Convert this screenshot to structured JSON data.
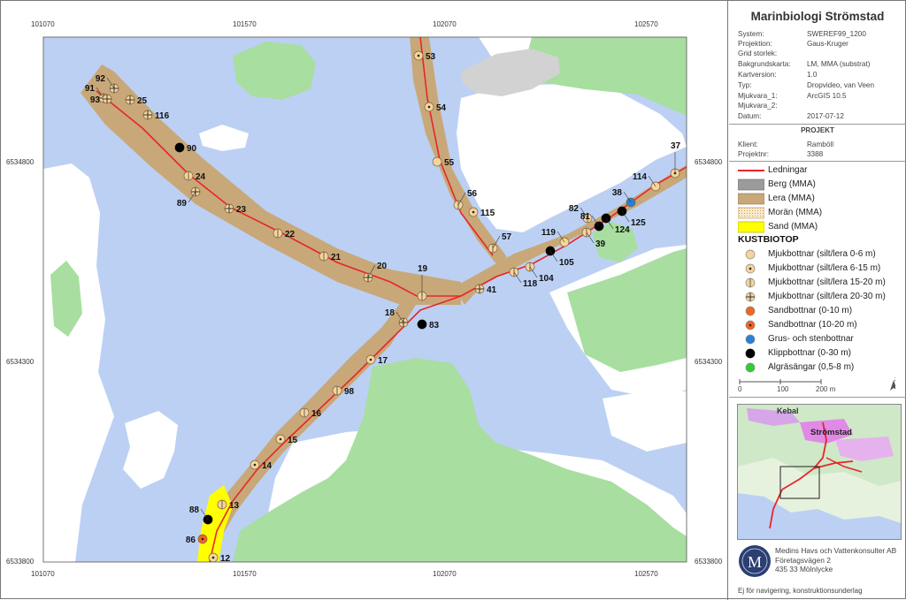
{
  "panel": {
    "title": "Marinbiologi Strömstad",
    "meta": [
      {
        "key": "System:",
        "value": "SWEREF99_1200"
      },
      {
        "key": "Projektion:",
        "value": "Gaus-Kruger"
      },
      {
        "key": "Grid storlek:",
        "value": ""
      },
      {
        "key": "Bakgrundskarta:",
        "value": "LM, MMA (substrat)"
      },
      {
        "key": "Kartversion:",
        "value": "1.0"
      },
      {
        "key": "Typ:",
        "value": "Dropvideo, van Veen"
      },
      {
        "key": "Mjukvara_1:",
        "value": "ArcGIS 10.5"
      },
      {
        "key": "Mjukvara_2:",
        "value": ""
      },
      {
        "key": "Datum:",
        "value": "2017-07-12"
      }
    ],
    "projekt_heading": "PROJEKT",
    "projekt": [
      {
        "key": "Klient:",
        "value": "Ramböll"
      },
      {
        "key": "Projektnr:",
        "value": "3388"
      }
    ],
    "legend": [
      {
        "label": "Ledningar",
        "symbol": "line",
        "color": "#e8252a"
      },
      {
        "label": "Berg (MMA)",
        "symbol": "rect",
        "color": "#9b9b9b"
      },
      {
        "label": "Lera (MMA)",
        "symbol": "rect",
        "color": "#c8a878"
      },
      {
        "label": "Morän (MMA)",
        "symbol": "dots",
        "color": "#f3dfb5"
      },
      {
        "label": "Sand (MMA)",
        "symbol": "rect",
        "color": "#ffff00"
      }
    ],
    "kustbiotop_heading": "KUSTBIOTOP",
    "kustbiotop": [
      {
        "label": "Mjukbottnar (silt/lera 0-6 m)",
        "style": "plain",
        "color": "#f6d49a"
      },
      {
        "label": "Mjukbottnar (silt/lera 6-15 m)",
        "style": "dot",
        "color": "#f6d49a"
      },
      {
        "label": "Mjukbottnar (silt/lera 15-20 m)",
        "style": "vline",
        "color": "#f6d49a"
      },
      {
        "label": "Mjukbottnar (silt/lera 20-30 m)",
        "style": "cross",
        "color": "#f6d49a"
      },
      {
        "label": "Sandbottnar (0-10 m)",
        "style": "plain",
        "color": "#f26522"
      },
      {
        "label": "Sandbottnar (10-20 m)",
        "style": "dot",
        "color": "#f26522"
      },
      {
        "label": "Grus- och stenbottnar",
        "style": "plain",
        "color": "#2a7fd6"
      },
      {
        "label": "Klippbottnar (0-30 m)",
        "style": "plain",
        "color": "#000000"
      },
      {
        "label": "Algräsängar (0,5-8 m)",
        "style": "plain",
        "color": "#33cc33"
      }
    ],
    "scale": {
      "labels": [
        "0",
        "100",
        "200 m"
      ]
    },
    "north_label": "N",
    "inset": {
      "labels": [
        "Kebal",
        "Strömstad"
      ]
    },
    "company": [
      "Medins Havs och Vattenkonsulter AB",
      "Företagsvägen 2",
      "435 33 Mölnlycke"
    ],
    "disclaimer": "Ej för navigering, konstruktionsunderlag"
  },
  "map": {
    "x_ticks": [
      "101070",
      "101570",
      "102070",
      "102570"
    ],
    "y_ticks": [
      "6534800",
      "6534300",
      "6533800"
    ],
    "colors": {
      "water": "#bcd0f4",
      "land": "#ffffff",
      "grass": "#a8dea0",
      "clay": "#c8a878",
      "rock": "#9b9b9b",
      "sand": "#ffff00",
      "cable": "#e8252a"
    },
    "stations": [
      {
        "id": "92",
        "type": "cross"
      },
      {
        "id": "91",
        "type": "cross"
      },
      {
        "id": "93",
        "type": "cross"
      },
      {
        "id": "25",
        "type": "cross"
      },
      {
        "id": "116",
        "type": "cross"
      },
      {
        "id": "90",
        "type": "rock"
      },
      {
        "id": "24",
        "type": "vline"
      },
      {
        "id": "89",
        "type": "cross"
      },
      {
        "id": "23",
        "type": "cross"
      },
      {
        "id": "22",
        "type": "vline"
      },
      {
        "id": "21",
        "type": "vline"
      },
      {
        "id": "20",
        "type": "cross"
      },
      {
        "id": "19",
        "type": "vline"
      },
      {
        "id": "41",
        "type": "cross"
      },
      {
        "id": "18",
        "type": "cross"
      },
      {
        "id": "83",
        "type": "rock"
      },
      {
        "id": "17",
        "type": "dot"
      },
      {
        "id": "98",
        "type": "vline"
      },
      {
        "id": "16",
        "type": "vline"
      },
      {
        "id": "15",
        "type": "dot"
      },
      {
        "id": "14",
        "type": "dot"
      },
      {
        "id": "13",
        "type": "vline"
      },
      {
        "id": "88",
        "type": "rock"
      },
      {
        "id": "86",
        "type": "sanddot"
      },
      {
        "id": "12",
        "type": "dot"
      },
      {
        "id": "53",
        "type": "dot"
      },
      {
        "id": "54",
        "type": "dot"
      },
      {
        "id": "55",
        "type": "plain"
      },
      {
        "id": "56",
        "type": "vline"
      },
      {
        "id": "115",
        "type": "dot"
      },
      {
        "id": "57",
        "type": "vline"
      },
      {
        "id": "118",
        "type": "vline"
      },
      {
        "id": "104",
        "type": "vline"
      },
      {
        "id": "105",
        "type": "rock"
      },
      {
        "id": "119",
        "type": "plain"
      },
      {
        "id": "39",
        "type": "vline"
      },
      {
        "id": "82",
        "type": "vline"
      },
      {
        "id": "81",
        "type": "rock"
      },
      {
        "id": "124",
        "type": "rock"
      },
      {
        "id": "38",
        "type": "gravel"
      },
      {
        "id": "125",
        "type": "rock"
      },
      {
        "id": "114",
        "type": "plain"
      },
      {
        "id": "37",
        "type": "dot"
      }
    ]
  }
}
